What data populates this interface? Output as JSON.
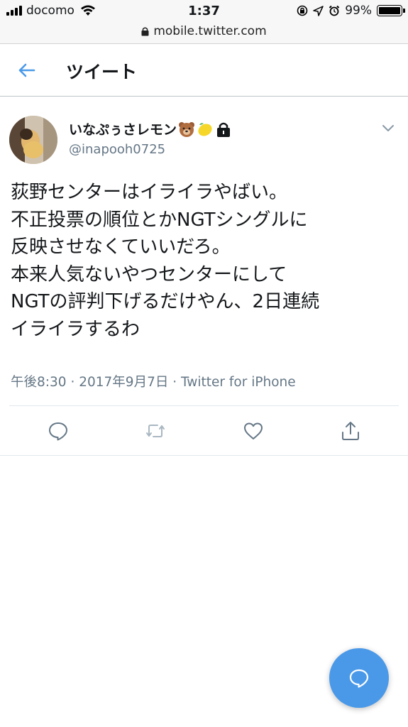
{
  "status_bar": {
    "carrier": "docomo",
    "time": "1:37",
    "battery": "99%",
    "battery_level": 0.99
  },
  "browser": {
    "url": "mobile.twitter.com"
  },
  "header": {
    "title": "ツイート"
  },
  "tweet": {
    "display_name": "いなぷぅさレモン",
    "handle": "@inapooh0725",
    "text_lines": [
      "荻野センターはイライラやばい。",
      "不正投票の順位とかNGTシングルに",
      "反映させなくていいだろ。",
      "本来人気ないやつセンターにして",
      "NGTの評判下げるだけやん、2日連続",
      "イライラするわ"
    ],
    "time": "午後8:30",
    "date": "2017年9月7日",
    "source": "Twitter for iPhone",
    "separator": "·"
  },
  "icons": {
    "back": "arrow-left-icon",
    "reply": "reply-icon",
    "retweet": "retweet-icon",
    "like": "heart-icon",
    "share": "share-icon",
    "compose": "compose-message-icon"
  },
  "colors": {
    "accent": "#4a99e9",
    "secondary_text": "#657786",
    "action_icon": "#657786",
    "retweet_disabled": "#aab8c2"
  }
}
